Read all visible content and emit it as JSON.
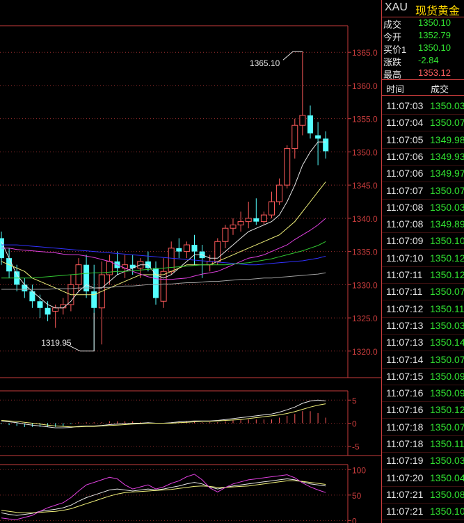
{
  "colors": {
    "up": "#ff5a5a",
    "down": "#54ffff",
    "grid": "#c83c3c",
    "green": "#32e632",
    "label_white": "#e6e6e6",
    "price_red": "#ff6060"
  },
  "header": {
    "symbol": "XAU",
    "name": "现货黄金"
  },
  "quote": [
    {
      "label": "成交",
      "value": "1350.10",
      "color": "#32e632"
    },
    {
      "label": "今开",
      "value": "1352.79",
      "color": "#32e632"
    },
    {
      "label": "买价1",
      "value": "1350.10",
      "color": "#32e632"
    },
    {
      "label": "涨跌",
      "value": "-2.84",
      "color": "#32e632"
    },
    {
      "label": "最高",
      "value": "1353.12",
      "color": "#ff6060"
    }
  ],
  "trades_header": {
    "time": "时间",
    "price": "成交"
  },
  "trades": [
    {
      "time": "11:07:03",
      "price": "1350.03"
    },
    {
      "time": "11:07:04",
      "price": "1350.07"
    },
    {
      "time": "11:07:05",
      "price": "1349.98"
    },
    {
      "time": "11:07:06",
      "price": "1349.93"
    },
    {
      "time": "11:07:06",
      "price": "1349.97"
    },
    {
      "time": "11:07:07",
      "price": "1350.07"
    },
    {
      "time": "11:07:08",
      "price": "1350.03"
    },
    {
      "time": "11:07:08",
      "price": "1349.89"
    },
    {
      "time": "11:07:09",
      "price": "1350.10"
    },
    {
      "time": "11:07:10",
      "price": "1350.12"
    },
    {
      "time": "11:07:11",
      "price": "1350.12"
    },
    {
      "time": "11:07:11",
      "price": "1350.07"
    },
    {
      "time": "11:07:12",
      "price": "1350.11"
    },
    {
      "time": "11:07:13",
      "price": "1350.03"
    },
    {
      "time": "11:07:13",
      "price": "1350.14"
    },
    {
      "time": "11:07:14",
      "price": "1350.07"
    },
    {
      "time": "11:07:15",
      "price": "1350.09"
    },
    {
      "time": "11:07:16",
      "price": "1350.09"
    },
    {
      "time": "11:07:16",
      "price": "1350.12"
    },
    {
      "time": "11:07:18",
      "price": "1350.07"
    },
    {
      "time": "11:07:18",
      "price": "1350.11"
    },
    {
      "time": "11:07:19",
      "price": "1350.03"
    },
    {
      "time": "11:07:20",
      "price": "1350.04"
    },
    {
      "time": "11:07:21",
      "price": "1350.08"
    },
    {
      "time": "11:07:21",
      "price": "1350.10"
    }
  ],
  "chart_data": {
    "type": "candlestick",
    "price_axis": {
      "ticks": [
        "1365.0",
        "1360.0",
        "1355.0",
        "1350.0",
        "1345.0",
        "1340.0",
        "1335.0",
        "1330.0",
        "1325.0",
        "1320.0"
      ],
      "ylim": [
        1316,
        1369
      ]
    },
    "annotations": {
      "high_label": "1365.10",
      "low_label": "1319.95"
    },
    "candles": [
      [
        1337.0,
        1338.0,
        1333.0,
        1334.0
      ],
      [
        1334.0,
        1335.5,
        1331.0,
        1332.0
      ],
      [
        1332.0,
        1333.0,
        1329.0,
        1330.0
      ],
      [
        1330.0,
        1331.0,
        1328.0,
        1329.0
      ],
      [
        1329.0,
        1330.0,
        1326.5,
        1327.5
      ],
      [
        1327.5,
        1328.5,
        1325.0,
        1326.5
      ],
      [
        1326.5,
        1327.5,
        1324.5,
        1325.5
      ],
      [
        1326.0,
        1327.0,
        1323.5,
        1326.5
      ],
      [
        1326.5,
        1328.0,
        1325.5,
        1327.0
      ],
      [
        1327.0,
        1331.5,
        1326.0,
        1330.0
      ],
      [
        1330.0,
        1334.0,
        1329.0,
        1333.0
      ],
      [
        1333.0,
        1334.5,
        1328.0,
        1329.0
      ],
      [
        1329.0,
        1333.0,
        1320.0,
        1326.5
      ],
      [
        1326.5,
        1333.5,
        1321.0,
        1331.5
      ],
      [
        1331.5,
        1334.5,
        1330.0,
        1333.5
      ],
      [
        1333.5,
        1335.0,
        1331.5,
        1332.5
      ],
      [
        1332.5,
        1334.5,
        1331.0,
        1333.0
      ],
      [
        1333.0,
        1334.5,
        1331.5,
        1332.5
      ],
      [
        1332.5,
        1334.0,
        1331.0,
        1333.5
      ],
      [
        1333.5,
        1335.0,
        1332.0,
        1332.5
      ],
      [
        1332.5,
        1333.5,
        1327.0,
        1328.0
      ],
      [
        1327.5,
        1334.0,
        1326.5,
        1332.0
      ],
      [
        1332.0,
        1336.5,
        1331.5,
        1335.5
      ],
      [
        1335.5,
        1337.0,
        1334.0,
        1335.0
      ],
      [
        1335.0,
        1336.5,
        1334.0,
        1336.0
      ],
      [
        1336.0,
        1337.5,
        1333.0,
        1335.0
      ],
      [
        1335.0,
        1336.0,
        1331.0,
        1334.0
      ],
      [
        1333.0,
        1334.5,
        1332.0,
        1333.5
      ],
      [
        1333.5,
        1337.0,
        1333.0,
        1336.5
      ],
      [
        1336.5,
        1339.0,
        1335.5,
        1338.5
      ],
      [
        1338.5,
        1340.0,
        1337.5,
        1339.0
      ],
      [
        1339.0,
        1341.0,
        1338.0,
        1339.5
      ],
      [
        1339.5,
        1342.5,
        1338.5,
        1340.0
      ],
      [
        1340.0,
        1343.0,
        1339.0,
        1339.5
      ],
      [
        1339.5,
        1341.0,
        1339.0,
        1340.5
      ],
      [
        1340.5,
        1344.0,
        1340.0,
        1342.5
      ],
      [
        1342.5,
        1346.0,
        1342.0,
        1345.0
      ],
      [
        1345.0,
        1351.0,
        1344.5,
        1350.5
      ],
      [
        1350.5,
        1355.0,
        1349.0,
        1354.0
      ],
      [
        1354.0,
        1365.1,
        1352.5,
        1355.5
      ],
      [
        1355.5,
        1357.0,
        1352.0,
        1352.8
      ],
      [
        1352.5,
        1354.5,
        1348.0,
        1352.0
      ],
      [
        1352.0,
        1353.1,
        1349.0,
        1350.1
      ]
    ],
    "ma_lines": [
      {
        "color": "#e6e6e6",
        "values": [
          1336.5,
          1334,
          1331.5,
          1330,
          1329,
          1328,
          1327,
          1326.5,
          1326.5,
          1327.5,
          1329,
          1330,
          1329.5,
          1329.5,
          1330.5,
          1331.5,
          1332,
          1332.5,
          1333,
          1333,
          1331.5,
          1331,
          1331.5,
          1332.5,
          1333.5,
          1334.5,
          1334.5,
          1334,
          1334,
          1335,
          1336,
          1337,
          1338,
          1338.5,
          1339,
          1339.5,
          1340.5,
          1342.5,
          1345,
          1348,
          1350,
          1351.5,
          1351.5
        ]
      },
      {
        "color": "#f0f07a",
        "values": [
          1333.5,
          1333,
          1332.5,
          1332,
          1331,
          1330.5,
          1330,
          1329.5,
          1329,
          1328.5,
          1328.5,
          1328.5,
          1328.5,
          1329,
          1329.5,
          1330,
          1330.5,
          1331,
          1331.5,
          1331.5,
          1331.5,
          1331.5,
          1332,
          1332.5,
          1333,
          1333,
          1333,
          1333,
          1333.5,
          1334,
          1334.5,
          1335,
          1335.5,
          1336,
          1336.5,
          1337,
          1337.5,
          1338.5,
          1339.5,
          1341,
          1342.5,
          1344,
          1345.5
        ]
      },
      {
        "color": "#e040e0",
        "values": [
          1335.5,
          1335.5,
          1335.3,
          1335.2,
          1335.1,
          1335,
          1334.9,
          1334.8,
          1334.6,
          1334.5,
          1334.5,
          1334.3,
          1334.1,
          1333.8,
          1333.5,
          1333,
          1332.5,
          1332,
          1331.6,
          1331.2,
          1330.9,
          1330.8,
          1330.8,
          1330.9,
          1331,
          1331.3,
          1331.6,
          1331.8,
          1332,
          1332.5,
          1333,
          1333.5,
          1334,
          1334.2,
          1334.5,
          1335,
          1335.5,
          1336,
          1336.8,
          1337.5,
          1338.2,
          1339,
          1340
        ]
      },
      {
        "color": "#3232ff",
        "values": [
          1336,
          1336,
          1336,
          1335.9,
          1335.8,
          1335.7,
          1335.6,
          1335.5,
          1335.4,
          1335.3,
          1335.2,
          1335.1,
          1335,
          1334.9,
          1334.8,
          1334.7,
          1334.6,
          1334.5,
          1334.4,
          1334.3,
          1334.2,
          1334.1,
          1334,
          1333.9,
          1333.8,
          1333.7,
          1333.6,
          1333.5,
          1333.4,
          1333.3,
          1333.2,
          1333.1,
          1333,
          1333,
          1333.1,
          1333.2,
          1333.3,
          1333.4,
          1333.5,
          1333.6,
          1333.8,
          1334,
          1334.3
        ]
      },
      {
        "color": "#32c832",
        "values": [
          1331,
          1331,
          1331,
          1331,
          1331,
          1331.1,
          1331.2,
          1331.3,
          1331.4,
          1331.5,
          1331.6,
          1331.7,
          1331.8,
          1331.8,
          1331.9,
          1332,
          1332,
          1332.1,
          1332.2,
          1332.3,
          1332.4,
          1332.5,
          1332.6,
          1332.7,
          1332.8,
          1332.9,
          1333,
          1333,
          1333,
          1333,
          1333.1,
          1333.2,
          1333.3,
          1333.5,
          1333.7,
          1333.9,
          1334.2,
          1334.5,
          1334.8,
          1335.1,
          1335.5,
          1335.9,
          1336.5
        ]
      },
      {
        "color": "#a0a0a0",
        "values": [
          1329.3,
          1329.3,
          1329.3,
          1329.3,
          1329.3,
          1329.3,
          1329.3,
          1329.4,
          1329.4,
          1329.4,
          1329.5,
          1329.5,
          1329.5,
          1329.6,
          1329.6,
          1329.7,
          1329.8,
          1329.8,
          1329.9,
          1330,
          1330,
          1330.1,
          1330.1,
          1330.2,
          1330.3,
          1330.3,
          1330.4,
          1330.5,
          1330.5,
          1330.6,
          1330.7,
          1330.8,
          1330.8,
          1330.9,
          1331,
          1331,
          1331.1,
          1331.2,
          1331.3,
          1331.4,
          1331.5,
          1331.6,
          1331.8
        ]
      }
    ],
    "macd": {
      "axis_ticks": [
        "5",
        "0",
        "-5"
      ],
      "ylim": [
        -7,
        7
      ],
      "dif": [
        0.5,
        0.3,
        0.1,
        -0.2,
        -0.4,
        -0.6,
        -0.8,
        -1,
        -1,
        -0.9,
        -0.7,
        -0.6,
        -0.6,
        -0.5,
        -0.3,
        -0.2,
        -0.1,
        0,
        0,
        0.1,
        0,
        0,
        0.1,
        0.3,
        0.4,
        0.5,
        0.5,
        0.5,
        0.6,
        0.8,
        1,
        1.2,
        1.4,
        1.6,
        1.8,
        2,
        2.4,
        2.9,
        3.5,
        4.3,
        4.8,
        5,
        4.8
      ],
      "dea": [
        0.6,
        0.5,
        0.4,
        0.2,
        0,
        -0.2,
        -0.4,
        -0.6,
        -0.7,
        -0.8,
        -0.8,
        -0.7,
        -0.7,
        -0.6,
        -0.5,
        -0.4,
        -0.3,
        -0.2,
        -0.1,
        0,
        0,
        0,
        0,
        0.1,
        0.2,
        0.3,
        0.4,
        0.4,
        0.5,
        0.6,
        0.7,
        0.8,
        1,
        1.2,
        1.4,
        1.6,
        1.8,
        2.1,
        2.5,
        3,
        3.5,
        3.9,
        4.2
      ]
    },
    "kdj": {
      "axis_ticks": [
        "100",
        "50",
        "0"
      ],
      "ylim": [
        -5,
        110
      ],
      "k": [
        15,
        12,
        10,
        12,
        14,
        18,
        20,
        22,
        25,
        30,
        38,
        45,
        50,
        55,
        60,
        62,
        60,
        58,
        60,
        62,
        60,
        62,
        65,
        68,
        72,
        75,
        72,
        66,
        62,
        65,
        68,
        70,
        72,
        74,
        76,
        78,
        80,
        82,
        80,
        76,
        72,
        70,
        68
      ],
      "d": [
        20,
        18,
        16,
        15,
        15,
        16,
        17,
        18,
        20,
        23,
        28,
        33,
        38,
        43,
        48,
        52,
        55,
        56,
        57,
        58,
        59,
        60,
        61,
        63,
        65,
        67,
        68,
        67,
        65,
        65,
        66,
        67,
        68,
        70,
        72,
        74,
        76,
        78,
        78,
        77,
        75,
        73,
        71
      ],
      "j": [
        5,
        3,
        2,
        6,
        10,
        18,
        25,
        30,
        35,
        45,
        58,
        70,
        75,
        80,
        85,
        82,
        70,
        62,
        66,
        70,
        62,
        66,
        73,
        78,
        86,
        91,
        80,
        64,
        56,
        65,
        72,
        76,
        80,
        82,
        84,
        86,
        88,
        90,
        84,
        74,
        66,
        60,
        55
      ]
    }
  }
}
